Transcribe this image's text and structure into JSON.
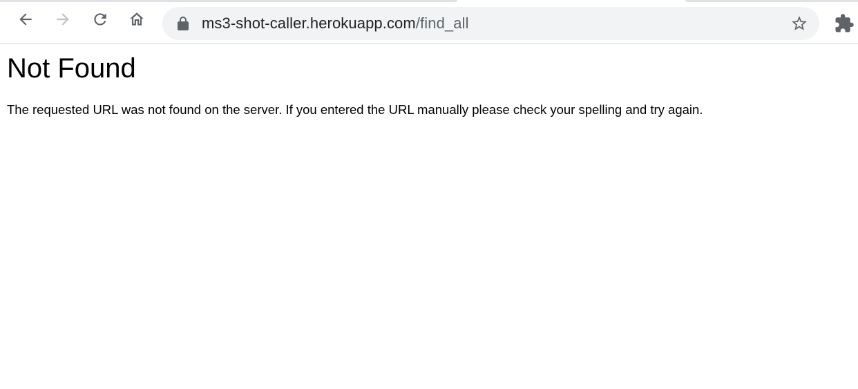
{
  "browser": {
    "toolbar": {
      "back_icon": "arrow-left-icon",
      "forward_icon": "arrow-right-icon",
      "reload_icon": "reload-icon",
      "home_icon": "home-icon",
      "bookmark_icon": "star-icon",
      "extensions_icon": "puzzle-icon",
      "forward_enabled": false
    },
    "omnibox": {
      "secure_icon": "lock-icon",
      "url_host": "ms3-shot-caller.herokuapp.com",
      "url_path": "/find_all"
    },
    "colors": {
      "icon": "#5f6368",
      "icon_disabled": "#bdc1c6",
      "omnibox_bg": "#f1f3f4",
      "url_text": "#202124"
    }
  },
  "page": {
    "heading": "Not Found",
    "message": "The requested URL was not found on the server. If you entered the URL manually please check your spelling and try again."
  }
}
